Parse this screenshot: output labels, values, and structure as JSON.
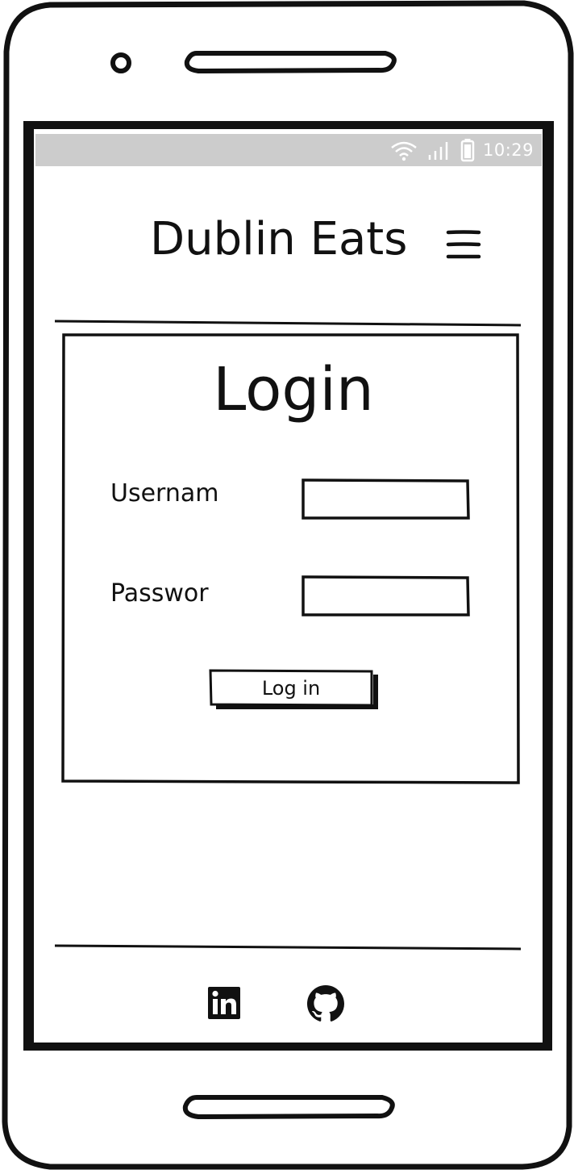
{
  "status_bar": {
    "time": "10:29",
    "wifi_icon": "wifi-icon",
    "signal_icon": "signal-icon",
    "battery_icon": "battery-icon"
  },
  "header": {
    "title": "Dublin Eats",
    "menu_icon": "hamburger-menu-icon"
  },
  "login": {
    "title": "Login",
    "username_label": "Usernam",
    "password_label": "Passwor",
    "username_value": "",
    "password_value": "",
    "submit_label": "Log in"
  },
  "footer": {
    "links": [
      {
        "icon": "linkedin-icon"
      },
      {
        "icon": "github-icon"
      }
    ]
  },
  "colors": {
    "ink": "#111111",
    "status_bar_bg": "#cccccc",
    "status_bar_fg": "#ffffff",
    "background": "#ffffff"
  }
}
